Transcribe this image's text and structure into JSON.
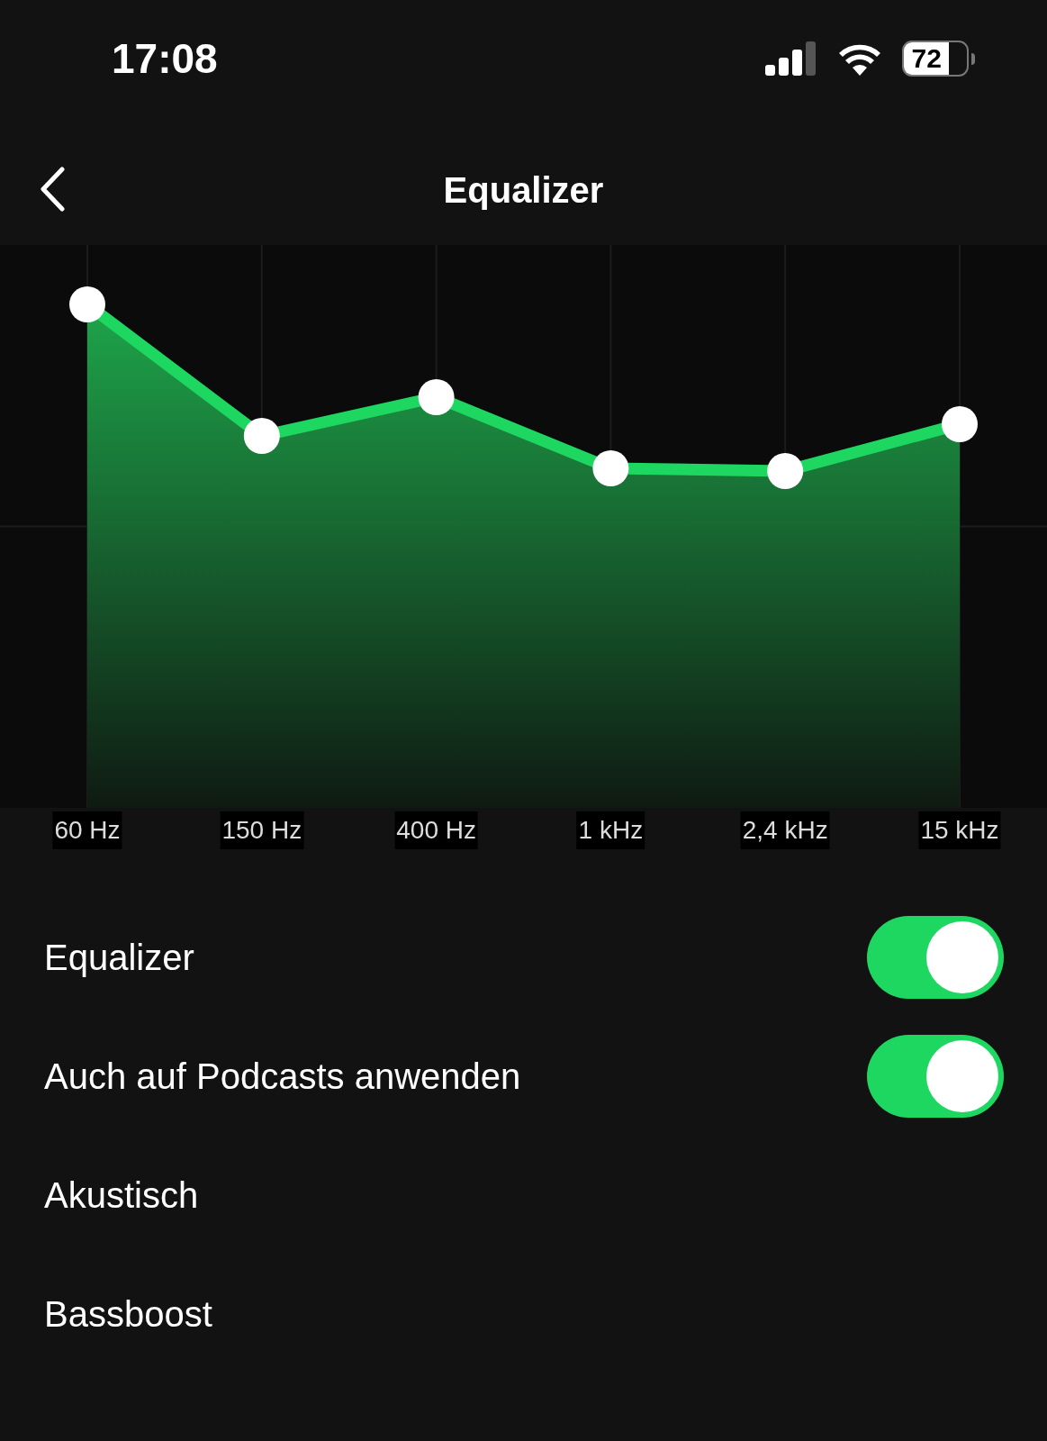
{
  "status_bar": {
    "time": "17:08",
    "battery": "72"
  },
  "header": {
    "title": "Equalizer"
  },
  "bands": [
    {
      "label": "60 Hz"
    },
    {
      "label": "150 Hz"
    },
    {
      "label": "400 Hz"
    },
    {
      "label": "1 kHz"
    },
    {
      "label": "2,4 kHz"
    },
    {
      "label": "15 kHz"
    }
  ],
  "settings": [
    {
      "kind": "toggle",
      "label": "Equalizer",
      "on": true
    },
    {
      "kind": "toggle",
      "label": "Auch auf Podcasts anwenden",
      "on": true
    },
    {
      "kind": "option",
      "label": "Akustisch"
    },
    {
      "kind": "option",
      "label": "Bassboost"
    }
  ]
}
